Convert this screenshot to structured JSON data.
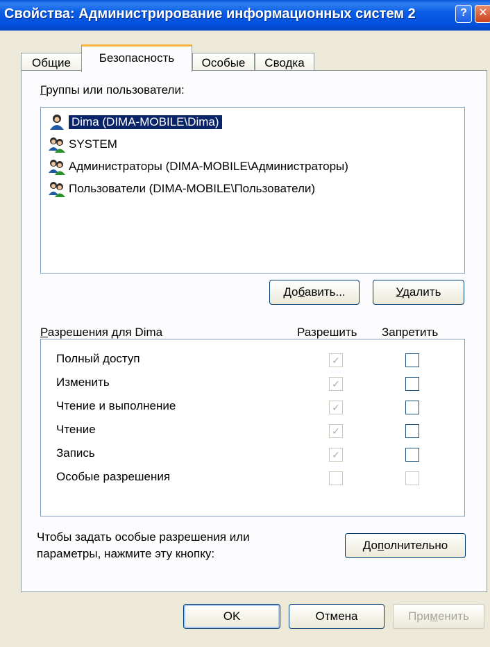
{
  "window": {
    "title": "Свойства: Администрирование информационных систем 2",
    "help_glyph": "?",
    "close_glyph": "✕"
  },
  "tabs": [
    {
      "label": "Общие",
      "active": false
    },
    {
      "label": "Безопасность",
      "active": true
    },
    {
      "label": "Особые",
      "active": false
    },
    {
      "label": "Сводка",
      "active": false
    }
  ],
  "groups": {
    "label_key": "Г",
    "label_rest": "руппы или пользователи:",
    "items": [
      {
        "text": "Dima (DIMA-MOBILE\\Dima)",
        "icon": "single-user-icon",
        "selected": true
      },
      {
        "text": "SYSTEM",
        "icon": "user-group-icon",
        "selected": false
      },
      {
        "text": "Администраторы (DIMA-MOBILE\\Администраторы)",
        "icon": "user-group-icon",
        "selected": false
      },
      {
        "text": "Пользователи (DIMA-MOBILE\\Пользователи)",
        "icon": "user-group-icon",
        "selected": false
      }
    ]
  },
  "buttons": {
    "add_pre": "До",
    "add_key": "б",
    "add_post": "авить...",
    "remove_key": "У",
    "remove_post": "далить",
    "advanced_pre": "До",
    "advanced_key": "п",
    "advanced_post": "олнительно",
    "ok": "OK",
    "cancel": "Отмена",
    "apply_pre": "При",
    "apply_key": "м",
    "apply_post": "енить"
  },
  "permissions": {
    "label_key": "Р",
    "label_rest": "азрешения для Dima",
    "col_allow": "Разрешить",
    "col_deny": "Запретить",
    "rows": [
      {
        "name": "Полный доступ",
        "allow": true,
        "deny": false
      },
      {
        "name": "Изменить",
        "allow": true,
        "deny": false
      },
      {
        "name": "Чтение и выполнение",
        "allow": true,
        "deny": false
      },
      {
        "name": "Чтение",
        "allow": true,
        "deny": false
      },
      {
        "name": "Запись",
        "allow": true,
        "deny": false
      },
      {
        "name": "Особые разрешения",
        "allow": false,
        "deny": false
      }
    ]
  },
  "hint": {
    "line1": "Чтобы задать особые разрешения или",
    "line2": "параметры, нажмите эту кнопку:"
  },
  "colors": {
    "titlebar": "#0350dc",
    "selection": "#0a246a",
    "tab_highlight": "#f7b33c",
    "dialog_bg": "#ece9d8"
  }
}
